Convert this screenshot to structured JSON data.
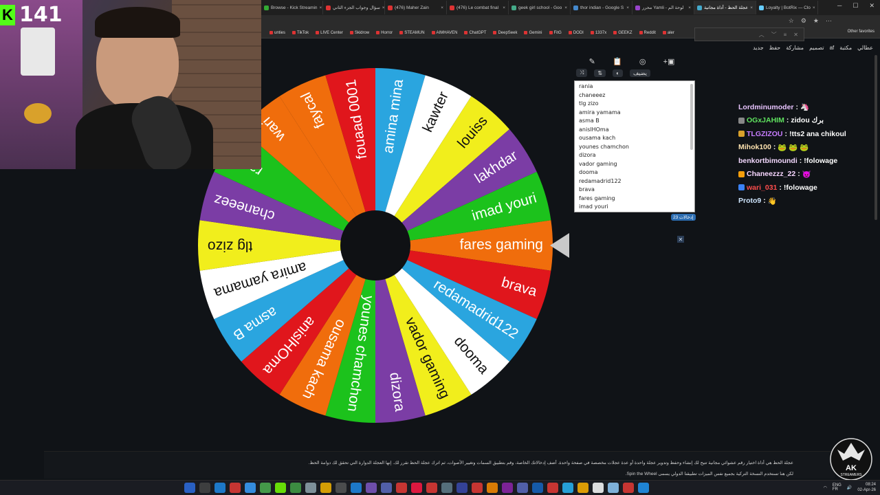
{
  "stream": {
    "viewer_count": "141",
    "kick_logo": "K"
  },
  "browser": {
    "tabs": [
      {
        "title": "Browse - Kick Streamin",
        "active": false
      },
      {
        "title": "سؤال وجواب الجزء الثاني",
        "active": false
      },
      {
        "title": "(476) Maher Zain",
        "active": false
      },
      {
        "title": "(476) Le combat final",
        "active": false
      },
      {
        "title": "geek girl school - Goo",
        "active": false
      },
      {
        "title": "thor indian - Google S",
        "active": false
      },
      {
        "title": "محرر Yamli - لوحة الم",
        "active": false
      },
      {
        "title": "عجلة الحظ - أداة مجانية",
        "active": true
      },
      {
        "title": "Loyalty | BotRix — Clo",
        "active": false
      }
    ],
    "bookmarks": [
      "unties",
      "TikTok",
      "LIVE Center",
      "Skidrow",
      "Horror",
      "STEAMUN",
      "AIMHAVEN",
      "ChatGPT",
      "DeepSeek",
      "Gemini",
      "FitG",
      "DODI",
      "1337x",
      "GEEKZ",
      "Reddit",
      "aler"
    ],
    "other_favorites": "Other favorites"
  },
  "site_nav": {
    "items": [
      "عطالي",
      "مكتبة",
      "af",
      "تصميم",
      "مشاركة",
      "حفظ",
      "جديد"
    ]
  },
  "wheel": {
    "segments": [
      {
        "label": "fares gaming",
        "color": "#f06d0c"
      },
      {
        "label": "brava",
        "color": "#e0161c"
      },
      {
        "label": "redamadrid122",
        "color": "#2aa5df"
      },
      {
        "label": "dooma",
        "color": "#ffffff"
      },
      {
        "label": "vador gaming",
        "color": "#f1ee1c"
      },
      {
        "label": "dizora",
        "color": "#7b3da5"
      },
      {
        "label": "younes chamchon",
        "color": "#1cc21c"
      },
      {
        "label": "ousama kach",
        "color": "#f06d0c"
      },
      {
        "label": "anislHOma",
        "color": "#e0161c"
      },
      {
        "label": "asma B",
        "color": "#2aa5df"
      },
      {
        "label": "amira yamama",
        "color": "#ffffff"
      },
      {
        "label": "tlg zizo",
        "color": "#f1ee1c"
      },
      {
        "label": "chaneeez",
        "color": "#7b3da5"
      },
      {
        "label": "rania",
        "color": "#1cc21c"
      },
      {
        "label": "wari",
        "color": "#f06d0c"
      },
      {
        "label": "faycal",
        "color": "#f06d0c"
      },
      {
        "label": "fouaad 0001",
        "color": "#e0161c"
      },
      {
        "label": "amina mina",
        "color": "#2aa5df"
      },
      {
        "label": "kawter",
        "color": "#ffffff"
      },
      {
        "label": "louiss",
        "color": "#f1ee1c"
      },
      {
        "label": "lakhdar",
        "color": "#7b3da5"
      },
      {
        "label": "imad youri",
        "color": "#1cc21c"
      }
    ]
  },
  "editor": {
    "add_label": "يضيف",
    "names": [
      "rania",
      "chaneeez",
      "tlg zizo",
      "amira yamama",
      "asma B",
      "anislHOma",
      "ousama kach",
      "younes chamchon",
      "dizora",
      "vador gaming",
      "dooma",
      "redamadrid122",
      "brava",
      "fares gaming",
      "imad youri"
    ],
    "entry_count": "23 إدخالات"
  },
  "chat": {
    "messages": [
      {
        "user": "Lordminumoder",
        "color": "#e8c4ff",
        "text": "🦄"
      },
      {
        "user": "OGxJAHIM",
        "color": "#5fe35f",
        "text": "zidou برك"
      },
      {
        "user": "TLGZIZOU",
        "color": "#c77dff",
        "text": "!tts2 ana chikoul"
      },
      {
        "user": "Mihok100",
        "color": "#ffe3b0",
        "text": "🐸 🐸 🐸"
      },
      {
        "user": "benkortbimoundi",
        "color": "#f4d9ff",
        "text": "!folowage"
      },
      {
        "user": "Chaneezzz_22",
        "color": "#f7d6ff",
        "text": "😈"
      },
      {
        "user": "wari_031",
        "color": "#ff4d4d",
        "text": "!folowage"
      },
      {
        "user": "Proto9",
        "color": "#cfe6ff",
        "text": "👋"
      }
    ]
  },
  "description": {
    "line1": "عجلة الحظ هي أداة اختيار رقم عشوائي مجانية تتيح لك إنشاء وحفظ وتدوير عجلة واحدة أو عدة عجلات مخصصة في صفحة واحدة. أضف إدخالاتك الخاصة، وقم بتطبيق السمات وتغيير الأصوات، ثم اترك عجلة الحظ تقرر لك. إنها العجلة الدوارة التي تحقق لك دوامة الحظ.",
    "line2": "لكن هنا تستخدم النسخة التركية بجميع نفس الميزات تطبيقنا الدولي يسمى Spin the Wheel."
  },
  "branding": {
    "logo_line1": "AK",
    "logo_line2": "STREAMERS"
  },
  "taskbar": {
    "lang": "ENG",
    "region": "FR",
    "time": "08:24",
    "date": "02-Apr-26"
  }
}
